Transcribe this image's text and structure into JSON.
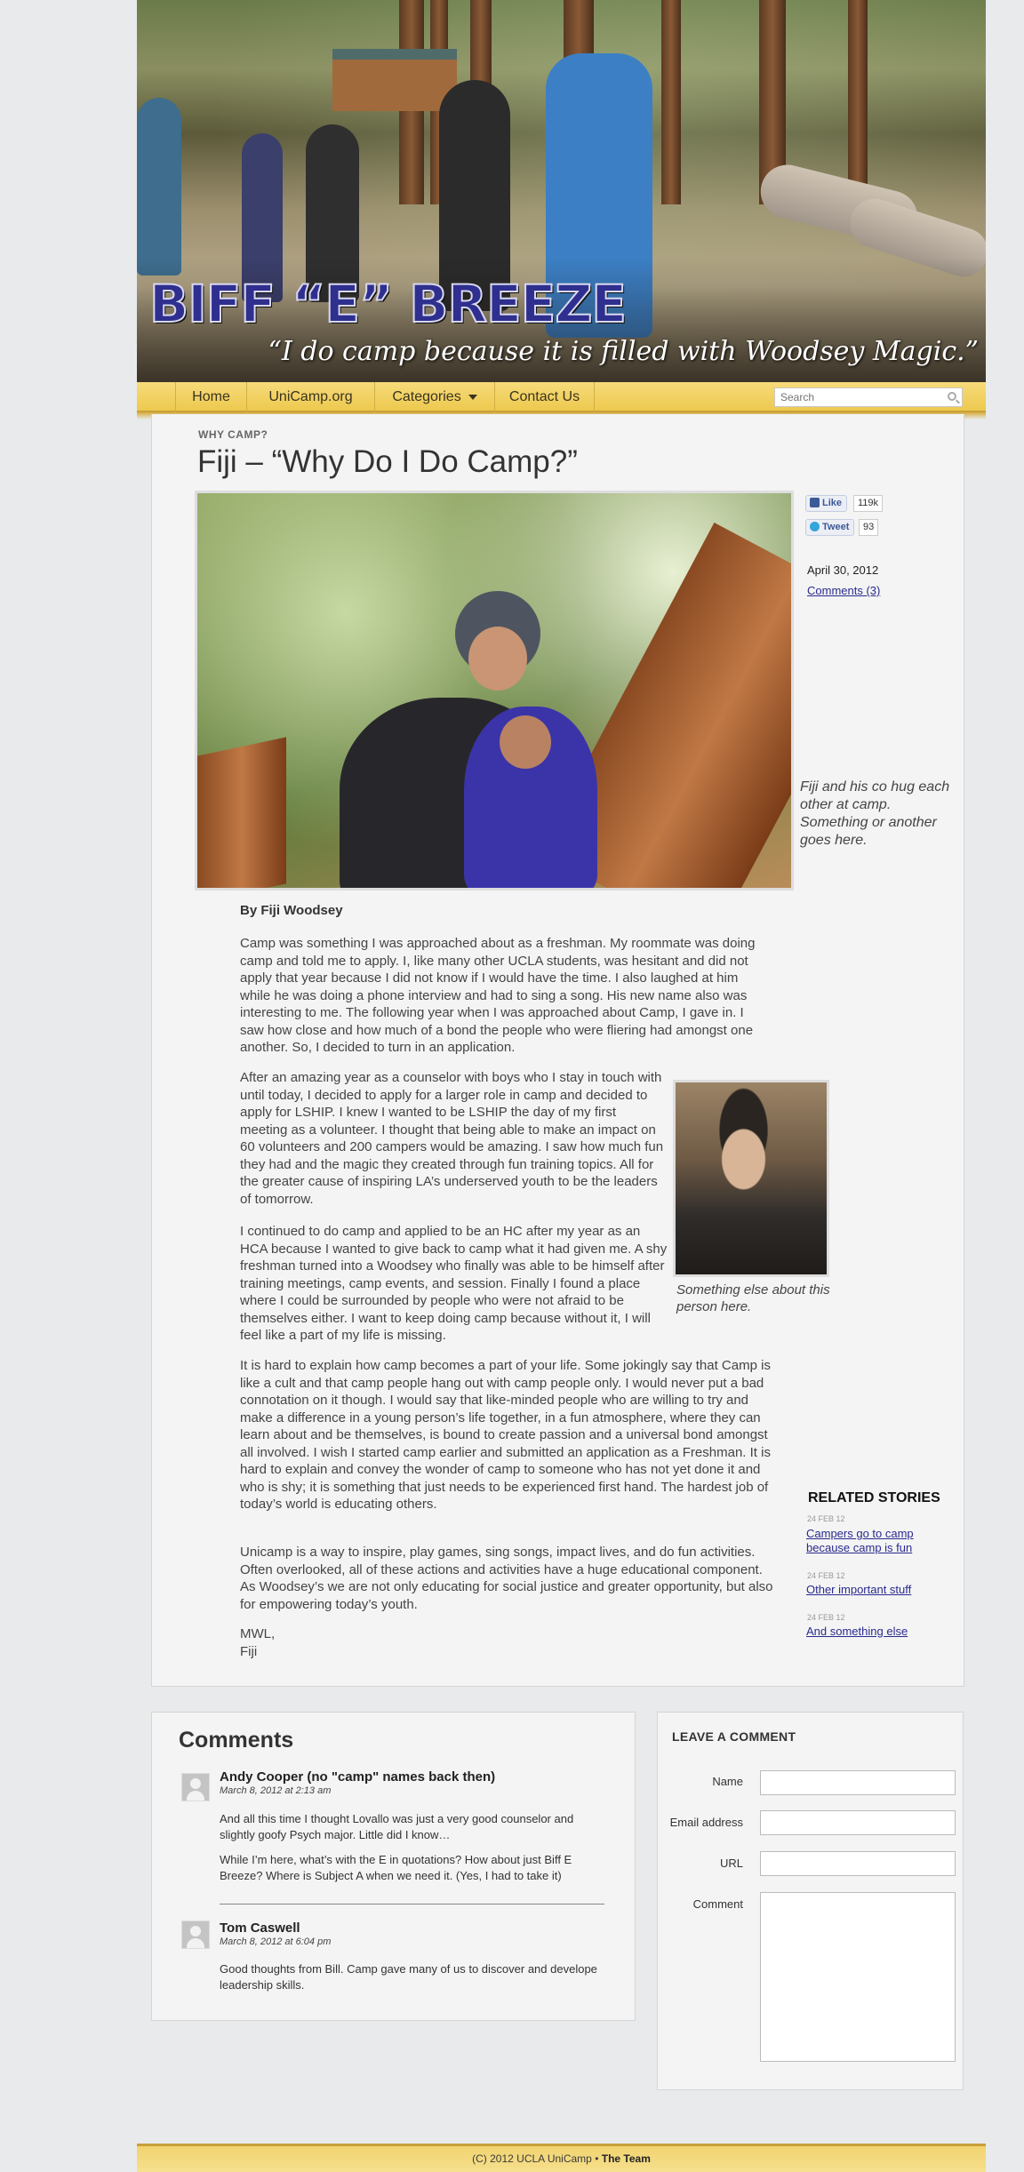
{
  "header": {
    "site_title": "BIFF “E” BREEZE",
    "tagline": "“I do camp because it is filled with Woodsey Magic.”"
  },
  "nav": {
    "items": [
      {
        "label": "Home"
      },
      {
        "label": "UniCamp.org"
      },
      {
        "label": "Categories",
        "has_dropdown": true
      },
      {
        "label": "Contact Us"
      }
    ],
    "search_placeholder": "Search"
  },
  "post": {
    "category": "WHY CAMP?",
    "title": "Fiji – “Why Do I Do Camp?”",
    "photo_caption": "Fiji and his co hug each other at camp. Something or another goes here.",
    "share": {
      "like_label": "Like",
      "like_count": "119k",
      "tweet_label": "Tweet",
      "tweet_count": "93"
    },
    "date": "April 30, 2012",
    "comments_link": "Comments (3)",
    "byline": "By Fiji Woodsey",
    "paragraphs": [
      "Camp was something I was approached about as a freshman. My roommate was doing camp and told me to apply. I, like many other UCLA students, was hesitant and did not apply that year because I did not know if I would have the time. I also laughed at him while he was doing a phone interview and had to sing a song. His new name also was interesting to me. The following year when I was approached about Camp, I gave in. I saw how close and how much of a bond the people who were fliering had amongst one another. So, I decided to turn in an application.",
      "After an amazing year as a counselor with boys who I stay in touch with until today, I decided to apply for a larger role in camp and decided to apply for LSHIP. I knew I wanted to be LSHIP the day of my first meeting as a volunteer. I thought that being able to make an impact on 60 volunteers and 200 campers would be amazing. I saw how much fun they had and the magic they created through fun training topics. All for the greater cause of inspiring LA’s underserved youth to be the leaders of tomorrow.",
      "I continued to do camp and applied to be an HC after my year as an HCA because I wanted to give back to camp what it had given me. A shy freshman turned into a Woodsey who finally was able to be himself after training meetings, camp events, and session. Finally I found a place where I could be surrounded by people who were not afraid to be themselves either. I want to keep doing camp because without it, I will feel like a part of my life is missing.",
      "It is hard to explain how camp becomes a part of your life. Some jokingly say that Camp is like a cult and that camp people hang out with camp people only. I would never put a bad connotation on it though. I would say that like-minded people who are willing to try and make a difference in a young person’s life together, in a fun atmosphere, where they can learn about and be themselves, is bound to create passion and a universal bond amongst all involved. I wish I started camp earlier and submitted an application as a Freshman. It is hard to explain and convey the wonder of camp to someone who has not yet done it and who is shy; it is something that just needs to be experienced first hand. The hardest job of today’s world is educating others.",
      "Unicamp is a way to inspire, play games, sing songs, impact lives, and do fun activities. Often overlooked, all of these actions and activities have a huge educational component. As Woodsey’s we are not only educating for social justice and greater opportunity, but also for empowering today’s youth."
    ],
    "signoff": [
      "MWL,",
      "Fiji"
    ],
    "side_photo_caption": "Something else about this person here."
  },
  "related": {
    "heading": "RELATED STORIES",
    "items": [
      {
        "date": "24 FEB 12",
        "title": "Campers go to camp because camp is fun"
      },
      {
        "date": "24 FEB 12",
        "title": "Other important stuff"
      },
      {
        "date": "24 FEB 12",
        "title": "And something else"
      }
    ]
  },
  "comments": {
    "heading": "Comments",
    "items": [
      {
        "author": "Andy Cooper (no \"camp\" names back then)",
        "date": "March 8, 2012 at 2:13 am",
        "paragraphs": [
          "And all this time I thought Lovallo was just a very good counselor and slightly goofy Psych major. Little did I know…",
          "While I’m here, what’s with the E in quotations? How about just Biff E Breeze? Where is Subject A when we need it. (Yes, I had to take it)"
        ]
      },
      {
        "author": "Tom Caswell",
        "date": "March 8, 2012 at 6:04 pm",
        "paragraphs": [
          "Good thoughts from Bill. Camp gave many of us to discover and develope leadership skills."
        ]
      }
    ]
  },
  "comment_form": {
    "heading": "LEAVE A COMMENT",
    "fields": [
      {
        "label": "Name",
        "value": ""
      },
      {
        "label": "Email address",
        "value": ""
      },
      {
        "label": "URL",
        "value": ""
      },
      {
        "label": "Comment",
        "value": ""
      }
    ]
  },
  "footer": {
    "copyright": "(C) 2012 UCLA UniCamp",
    "separator": "•",
    "team_link": "The Team"
  },
  "colors": {
    "nav_gold": "#edc94e",
    "link": "#2a2a8f",
    "title_purple": "#2f2f8f"
  }
}
